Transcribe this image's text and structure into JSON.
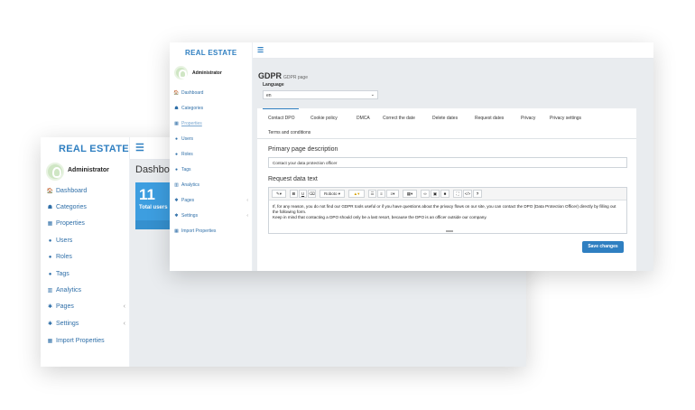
{
  "back_window": {
    "brand": "REAL ESTATE",
    "menu_icon": "hamburger-icon",
    "admin_name": "Administrator",
    "nav": [
      {
        "label": "Dashboard",
        "icon": "home-icon",
        "glyph": "🏠"
      },
      {
        "label": "Categories",
        "icon": "sitemap-icon",
        "glyph": "☗"
      },
      {
        "label": "Properties",
        "icon": "building-icon",
        "glyph": "▦"
      },
      {
        "label": "Users",
        "icon": "user-icon",
        "glyph": "●"
      },
      {
        "label": "Roles",
        "icon": "user-icon",
        "glyph": "●"
      },
      {
        "label": "Tags",
        "icon": "user-icon",
        "glyph": "●"
      },
      {
        "label": "Analytics",
        "icon": "bar-chart-icon",
        "glyph": "▥"
      },
      {
        "label": "Pages",
        "icon": "gear-icon",
        "glyph": "✱"
      },
      {
        "label": "Settings",
        "icon": "gear-icon",
        "glyph": "✱"
      },
      {
        "label": "Import Properties",
        "icon": "building-icon",
        "glyph": "▦"
      }
    ],
    "dashboard_title": "Dashboa",
    "stat": {
      "value": "11",
      "label": "Total users"
    }
  },
  "front_window": {
    "brand": "REAL ESTATE",
    "menu_icon": "hamburger-icon",
    "admin_name": "Administrator",
    "nav": [
      {
        "label": "Dashboard",
        "icon": "home-icon",
        "glyph": "🏠"
      },
      {
        "label": "Categories",
        "icon": "sitemap-icon",
        "glyph": "☗"
      },
      {
        "label": "Properties",
        "icon": "building-icon",
        "glyph": "▦"
      },
      {
        "label": "Users",
        "icon": "user-icon",
        "glyph": "●"
      },
      {
        "label": "Roles",
        "icon": "user-icon",
        "glyph": "●"
      },
      {
        "label": "Tags",
        "icon": "user-icon",
        "glyph": "●"
      },
      {
        "label": "Analytics",
        "icon": "bar-chart-icon",
        "glyph": "▥"
      },
      {
        "label": "Pages",
        "icon": "gear-icon",
        "glyph": "✱"
      },
      {
        "label": "Settings",
        "icon": "gear-icon",
        "glyph": "✱"
      },
      {
        "label": "Import Properties",
        "icon": "building-icon",
        "glyph": "▦"
      }
    ],
    "page_title": "GDPR",
    "page_subtitle": "GDPR page",
    "language_label": "Language",
    "language_value": "en",
    "tabs": [
      "Contact DPO",
      "Cookie policy",
      "DMCA",
      "Correct the date",
      "Delete dates",
      "Request dates",
      "Privacy",
      "Privacy settings",
      "Terms and conditions"
    ],
    "active_tab": "Contact DPO",
    "primary_label": "Primary page description",
    "primary_value": "Contact your data protection officer",
    "request_label": "Request data text",
    "toolbar": {
      "font_name": "Roboto",
      "buttons": [
        "magic-icon",
        "bold-icon",
        "underline-icon",
        "eraser-icon",
        "font-dropdown",
        "color-icon",
        "unordered-list-icon",
        "ordered-list-icon",
        "align-icon",
        "table-icon",
        "link-icon",
        "image-icon",
        "video-icon",
        "fullscreen-icon",
        "code-icon",
        "help-icon"
      ]
    },
    "editor_text_1": "If, for any reason, you do not find our GDPR tools useful or if you have questions about the privacy flows on our site, you can contact the DPO (Data Protection Officer) directly by filling out the following form.",
    "editor_text_2": "Keep in mind that contacting a DPO should only be a last resort, because the DPO is an officer outside our company.",
    "save_label": "Save changes"
  },
  "colors": {
    "accent": "#2f7fc1",
    "stat_card": "#3d9ee0",
    "main_bg": "#e9ecef"
  }
}
